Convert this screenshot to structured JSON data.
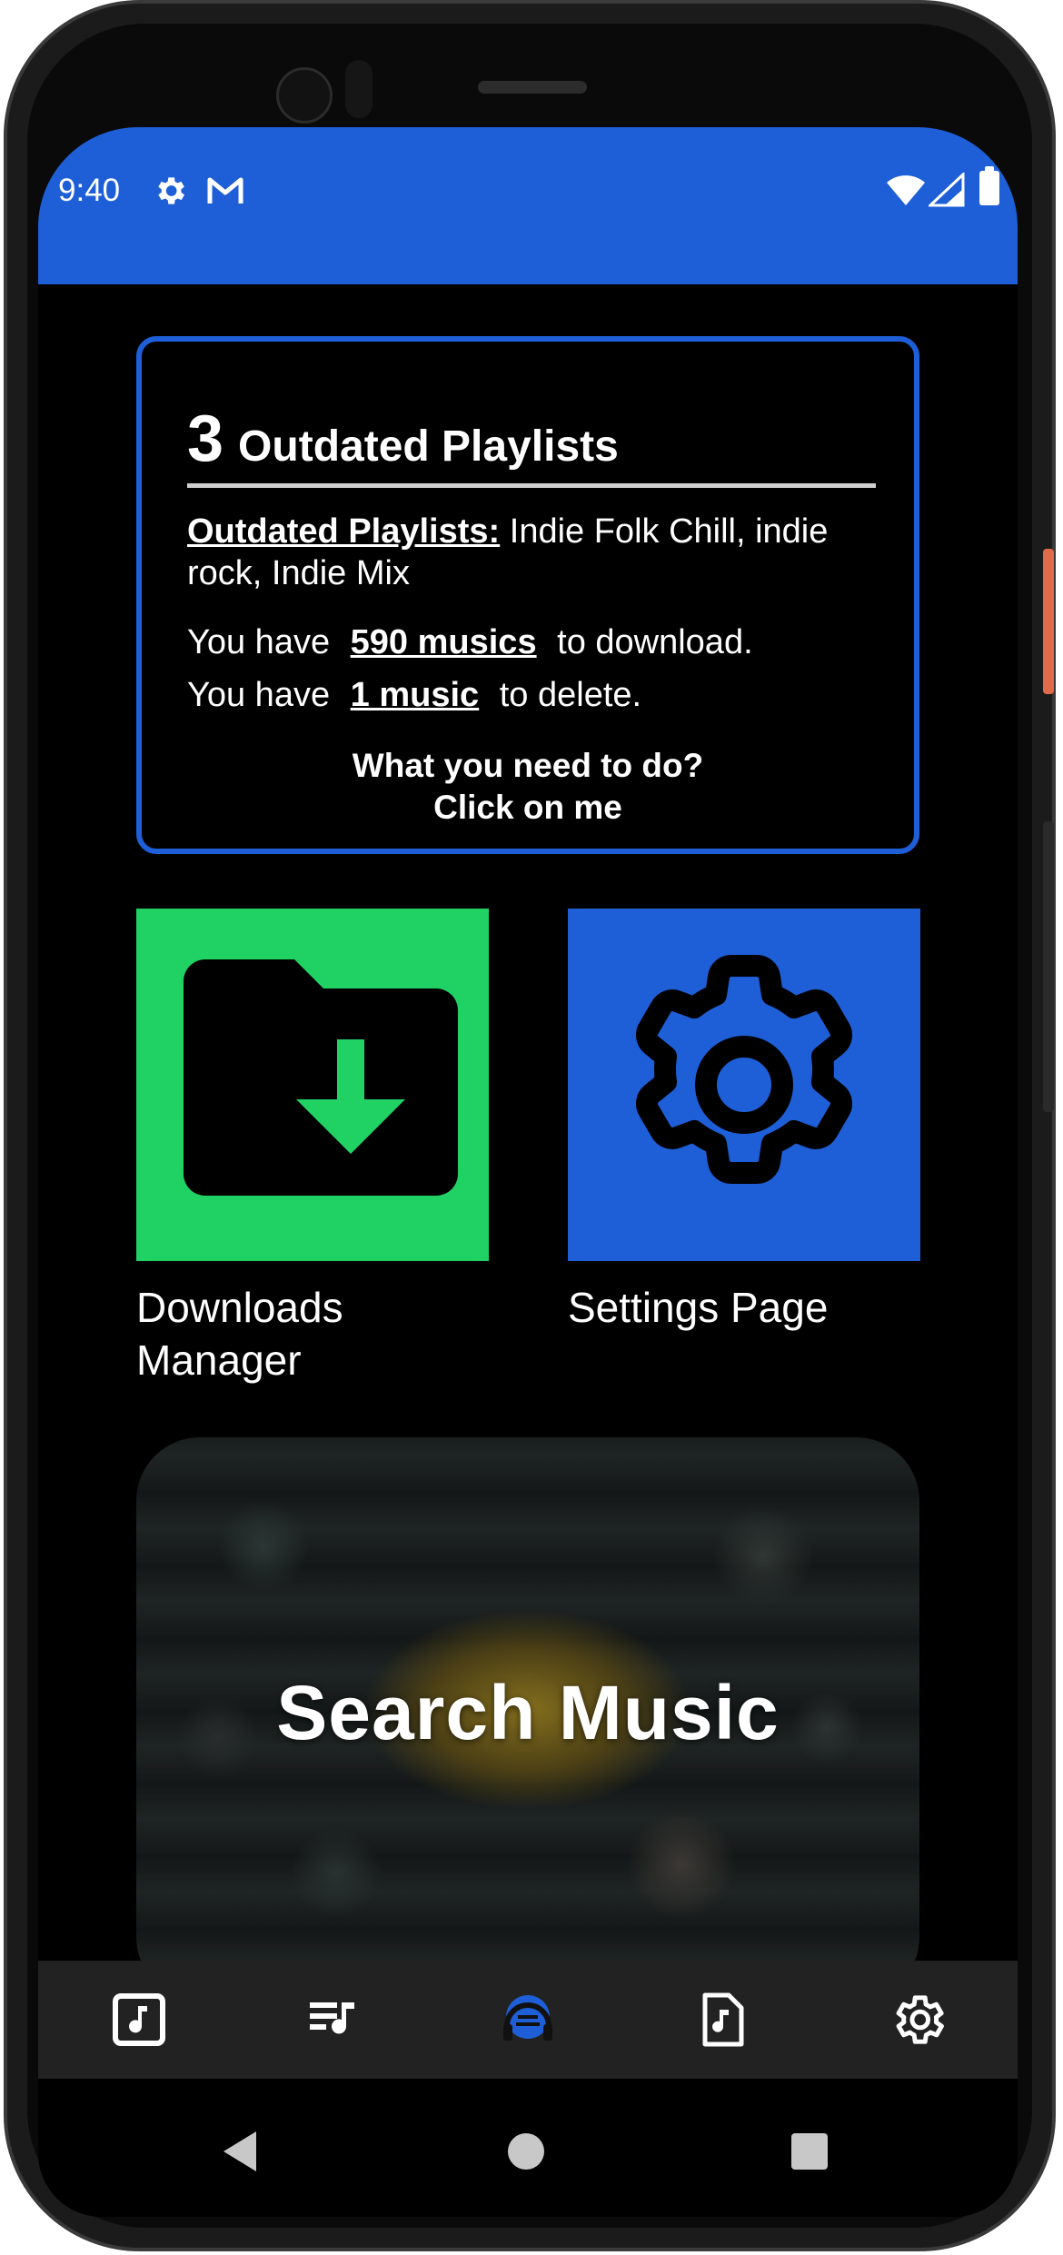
{
  "statusbar": {
    "time": "9:40",
    "icons": [
      "gear-icon",
      "gmail-icon",
      "wifi-icon",
      "signal-icon",
      "battery-icon"
    ],
    "background": "#1e5fd8"
  },
  "outdated_card": {
    "count": "3",
    "title": "Outdated Playlists",
    "playlists_label": "Outdated Playlists:",
    "playlists_value": "Indie Folk Chill, indie rock, Indie Mix",
    "download_prefix": "You have",
    "download_count": "590 musics",
    "download_suffix": "to download.",
    "delete_prefix": "You have",
    "delete_count": "1 music",
    "delete_suffix": "to delete.",
    "cta_line1": "What you need to do?",
    "cta_line2": "Click on me",
    "border_color": "#1e5fd8"
  },
  "tiles": {
    "downloads": {
      "label": "Downloads Manager",
      "icon": "folder-download-icon",
      "color": "#20d264"
    },
    "settings": {
      "label": "Settings Page",
      "icon": "gear-icon",
      "color": "#1e5fd8"
    }
  },
  "search_banner": {
    "title": "Search Music"
  },
  "bottom_nav": {
    "items": [
      {
        "icon": "music-note-square-icon"
      },
      {
        "icon": "playlist-icon"
      },
      {
        "icon": "app-logo-headphones-icon"
      },
      {
        "icon": "music-file-icon"
      },
      {
        "icon": "gear-icon"
      }
    ]
  },
  "system_nav": {
    "icons": [
      "back-icon",
      "home-icon",
      "recents-icon"
    ]
  }
}
